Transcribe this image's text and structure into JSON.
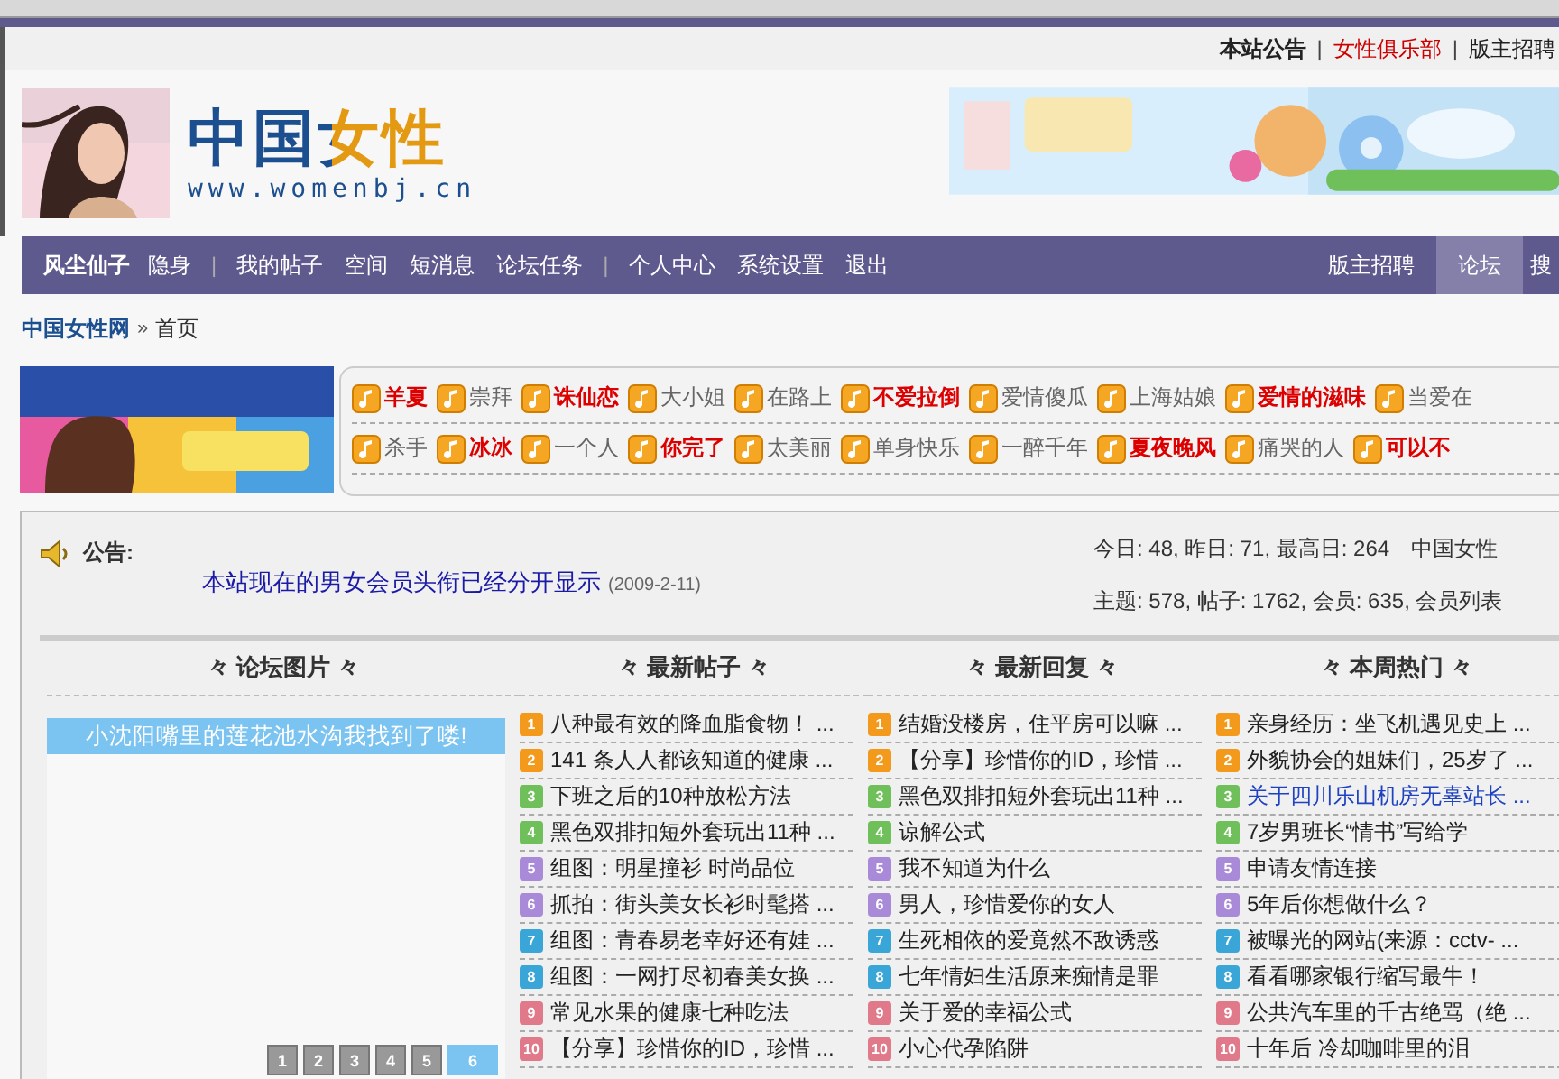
{
  "top_links": [
    {
      "label": "本站公告",
      "kind": "bold"
    },
    {
      "label": "|",
      "kind": "sep"
    },
    {
      "label": "女性俱乐部",
      "kind": "red"
    },
    {
      "label": "|",
      "kind": "sep"
    },
    {
      "label": "版主招聘",
      "kind": "plain"
    }
  ],
  "logo": {
    "title": "中国女性",
    "url": "www.womenbj.cn"
  },
  "nav": {
    "user": "风尘仙子",
    "items": [
      {
        "label": "隐身",
        "kind": "link"
      },
      {
        "label": "|",
        "kind": "sep"
      },
      {
        "label": "我的帖子",
        "kind": "link"
      },
      {
        "label": "空间",
        "kind": "link"
      },
      {
        "label": "短消息",
        "kind": "link"
      },
      {
        "label": "论坛任务",
        "kind": "link"
      },
      {
        "label": "|",
        "kind": "sep"
      },
      {
        "label": "个人中心",
        "kind": "link"
      },
      {
        "label": "系统设置",
        "kind": "link"
      },
      {
        "label": "退出",
        "kind": "link"
      }
    ],
    "right": [
      {
        "label": "版主招聘",
        "selected": false
      },
      {
        "label": "论坛",
        "selected": true
      },
      {
        "label": "搜",
        "selected": false
      }
    ]
  },
  "breadcrumb": {
    "home": "中国女性网",
    "sep": "»",
    "current": "首页"
  },
  "ringtones": [
    [
      {
        "label": "羊夏",
        "hot": true
      },
      {
        "label": "崇拜",
        "hot": false
      },
      {
        "label": "诛仙恋",
        "hot": true
      },
      {
        "label": "大小姐",
        "hot": false
      },
      {
        "label": "在路上",
        "hot": false
      },
      {
        "label": "不爱拉倒",
        "hot": true
      },
      {
        "label": "爱情傻瓜",
        "hot": false
      },
      {
        "label": "上海姑娘",
        "hot": false
      },
      {
        "label": "爱情的滋味",
        "hot": true
      },
      {
        "label": "当爱在",
        "hot": false
      }
    ],
    [
      {
        "label": "杀手",
        "hot": false
      },
      {
        "label": "冰冰",
        "hot": true
      },
      {
        "label": "一个人",
        "hot": false
      },
      {
        "label": "你完了",
        "hot": true
      },
      {
        "label": "太美丽",
        "hot": false
      },
      {
        "label": "单身快乐",
        "hot": false
      },
      {
        "label": "一醉千年",
        "hot": false
      },
      {
        "label": "夏夜晚风",
        "hot": true
      },
      {
        "label": "痛哭的人",
        "hot": false
      },
      {
        "label": "可以不",
        "hot": true
      }
    ]
  ],
  "notice": {
    "label": "公告:",
    "items": [
      {
        "title": "本站现在的男女会员头衔已经分开显示",
        "date": "(2009-2-11)"
      }
    ],
    "stats": [
      [
        "今日: 48, 昨日: 71, 最高日: 264",
        "中国女性"
      ],
      [
        "主题: 578, 帖子: 1762, 会员: 635, 会员列表"
      ]
    ]
  },
  "sections": [
    {
      "title": "々 论坛图片 々",
      "kind": "pictures",
      "caption": "小沈阳嘴里的莲花池水沟我找到了喽!",
      "pages": [
        {
          "label": "1",
          "selected": false
        },
        {
          "label": "2",
          "selected": false
        },
        {
          "label": "3",
          "selected": false
        },
        {
          "label": "4",
          "selected": false
        },
        {
          "label": "5",
          "selected": false
        },
        {
          "label": "6",
          "selected": true
        }
      ]
    },
    {
      "title": "々 最新帖子 々",
      "kind": "list",
      "items": [
        {
          "no": "1",
          "title": "八种最有效的降血脂食物！ ...",
          "hover": false
        },
        {
          "no": "2",
          "title": "141 条人人都该知道的健康 ...",
          "hover": false
        },
        {
          "no": "3",
          "title": "下班之后的10种放松方法",
          "hover": false
        },
        {
          "no": "4",
          "title": "黑色双排扣短外套玩出11种 ...",
          "hover": false
        },
        {
          "no": "5",
          "title": "组图：明星撞衫 时尚品位",
          "hover": false
        },
        {
          "no": "6",
          "title": "抓拍：街头美女长衫时髦搭 ...",
          "hover": false
        },
        {
          "no": "7",
          "title": "组图：青春易老幸好还有娃 ...",
          "hover": false
        },
        {
          "no": "8",
          "title": "组图：一网打尽初春美女换 ...",
          "hover": false
        },
        {
          "no": "9",
          "title": "常见水果的健康七种吃法",
          "hover": false
        },
        {
          "no": "10",
          "title": "【分享】珍惜你的ID，珍惜 ...",
          "hover": false
        }
      ]
    },
    {
      "title": "々 最新回复 々",
      "kind": "list",
      "items": [
        {
          "no": "1",
          "title": "结婚没楼房，住平房可以嘛 ...",
          "hover": false
        },
        {
          "no": "2",
          "title": "【分享】珍惜你的ID，珍惜 ...",
          "hover": false
        },
        {
          "no": "3",
          "title": "黑色双排扣短外套玩出11种 ...",
          "hover": false
        },
        {
          "no": "4",
          "title": "谅解公式",
          "hover": false
        },
        {
          "no": "5",
          "title": "我不知道为什么",
          "hover": false
        },
        {
          "no": "6",
          "title": "男人，珍惜爱你的女人",
          "hover": false
        },
        {
          "no": "7",
          "title": "生死相依的爱竟然不敌诱惑",
          "hover": false
        },
        {
          "no": "8",
          "title": "七年情妇生活原来痴情是罪",
          "hover": false
        },
        {
          "no": "9",
          "title": "关于爱的幸福公式",
          "hover": false
        },
        {
          "no": "10",
          "title": "小心代孕陷阱",
          "hover": false
        }
      ]
    },
    {
      "title": "々 本周热门 々",
      "kind": "list",
      "items": [
        {
          "no": "1",
          "title": "亲身经历：坐飞机遇见史上 ...",
          "hover": false
        },
        {
          "no": "2",
          "title": "外貌协会的姐妹们，25岁了 ...",
          "hover": false
        },
        {
          "no": "3",
          "title": "关于四川乐山机房无辜站长 ...",
          "hover": true
        },
        {
          "no": "4",
          "title": "7岁男班长“情书”写给学",
          "hover": false
        },
        {
          "no": "5",
          "title": "申请友情连接",
          "hover": false
        },
        {
          "no": "6",
          "title": "5年后你想做什么？",
          "hover": false
        },
        {
          "no": "7",
          "title": "被曝光的网站(来源：cctv- ...",
          "hover": false
        },
        {
          "no": "8",
          "title": "看看哪家银行缩写最牛！",
          "hover": false
        },
        {
          "no": "9",
          "title": "公共汽车里的千古绝骂（绝 ...",
          "hover": false
        },
        {
          "no": "10",
          "title": "十年后 冷却咖啡里的泪",
          "hover": false
        }
      ]
    }
  ]
}
